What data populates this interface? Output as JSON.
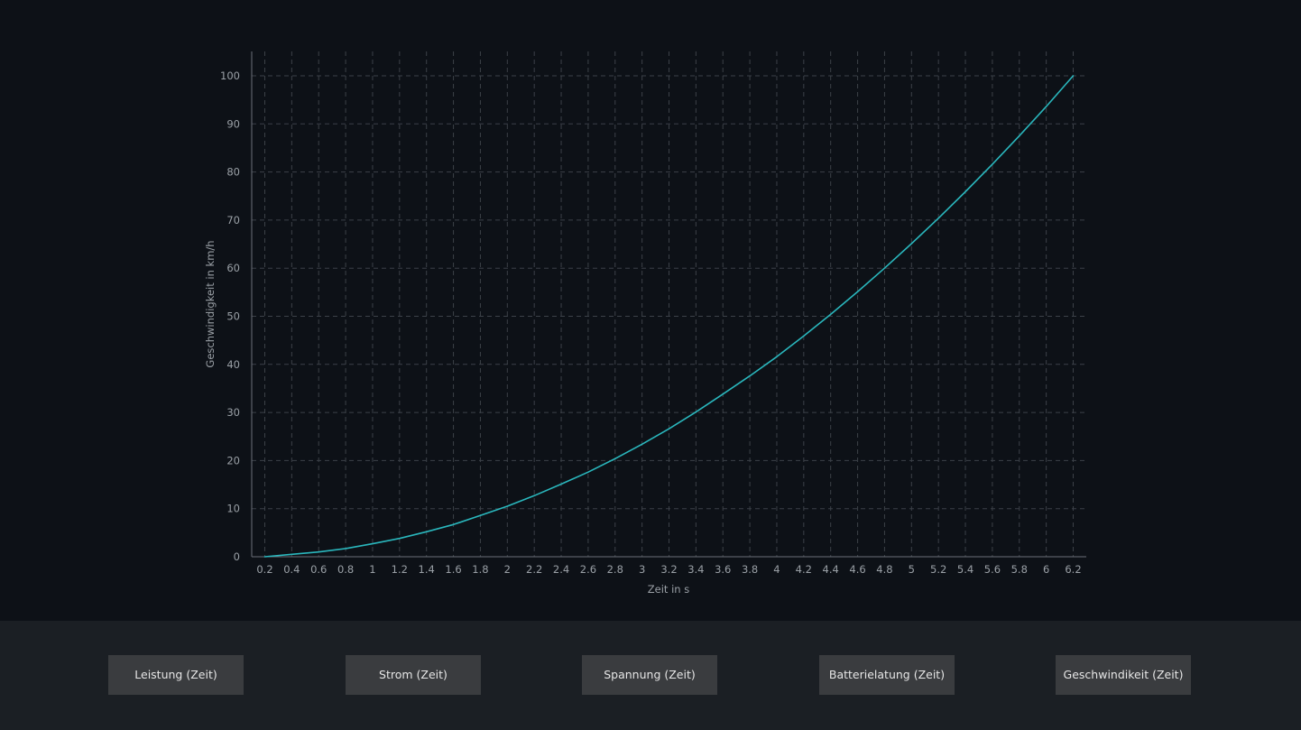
{
  "chart_data": {
    "type": "line",
    "xlabel": "Zeit in s",
    "ylabel": "Geschwindigkeit in km/h",
    "xlim": [
      0.2,
      6.2
    ],
    "ylim": [
      0,
      100
    ],
    "x_ticks": [
      "0.2",
      "0.4",
      "0.6",
      "0.8",
      "1",
      "1.2",
      "1.4",
      "1.6",
      "1.8",
      "2",
      "2.2",
      "2.4",
      "2.6",
      "2.8",
      "3",
      "3.2",
      "3.4",
      "3.6",
      "3.8",
      "4",
      "4.2",
      "4.4",
      "4.6",
      "4.8",
      "5",
      "5.2",
      "5.4",
      "5.6",
      "5.8",
      "6",
      "6.2"
    ],
    "y_ticks": [
      "0",
      "10",
      "20",
      "30",
      "40",
      "50",
      "60",
      "70",
      "80",
      "90",
      "100"
    ],
    "grid": true,
    "line_color": "#2ab7bd",
    "series": [
      {
        "x": [
          0.2,
          0.4,
          0.6,
          0.8,
          1.0,
          1.2,
          1.4,
          1.6,
          1.8,
          2.0,
          2.2,
          2.4,
          2.6,
          2.8,
          3.0,
          3.2,
          3.4,
          3.6,
          3.8,
          4.0,
          4.2,
          4.4,
          4.6,
          4.8,
          5.0,
          5.2,
          5.4,
          5.6,
          5.8,
          6.0,
          6.2
        ],
        "y": [
          0.0,
          0.5,
          1.0,
          1.7,
          2.7,
          3.8,
          5.2,
          6.7,
          8.6,
          10.5,
          12.7,
          15.1,
          17.6,
          20.4,
          23.4,
          26.6,
          30.1,
          33.8,
          37.6,
          41.6,
          45.9,
          50.4,
          55.1,
          60.0,
          65.1,
          70.4,
          75.9,
          81.6,
          87.5,
          93.6,
          100.0
        ]
      }
    ]
  },
  "buttons": [
    {
      "label": "Leistung (Zeit)"
    },
    {
      "label": "Strom (Zeit)"
    },
    {
      "label": "Spannung (Zeit)"
    },
    {
      "label": "Batterielatung (Zeit)"
    },
    {
      "label": "Geschwindikeit (Zeit)"
    }
  ],
  "colors": {
    "background": "#0d1117",
    "button_bar": "#1b1f24",
    "button": "#3a3c3f",
    "grid": "#3c4148",
    "axis": "#6b7078",
    "line": "#2ab7bd"
  }
}
